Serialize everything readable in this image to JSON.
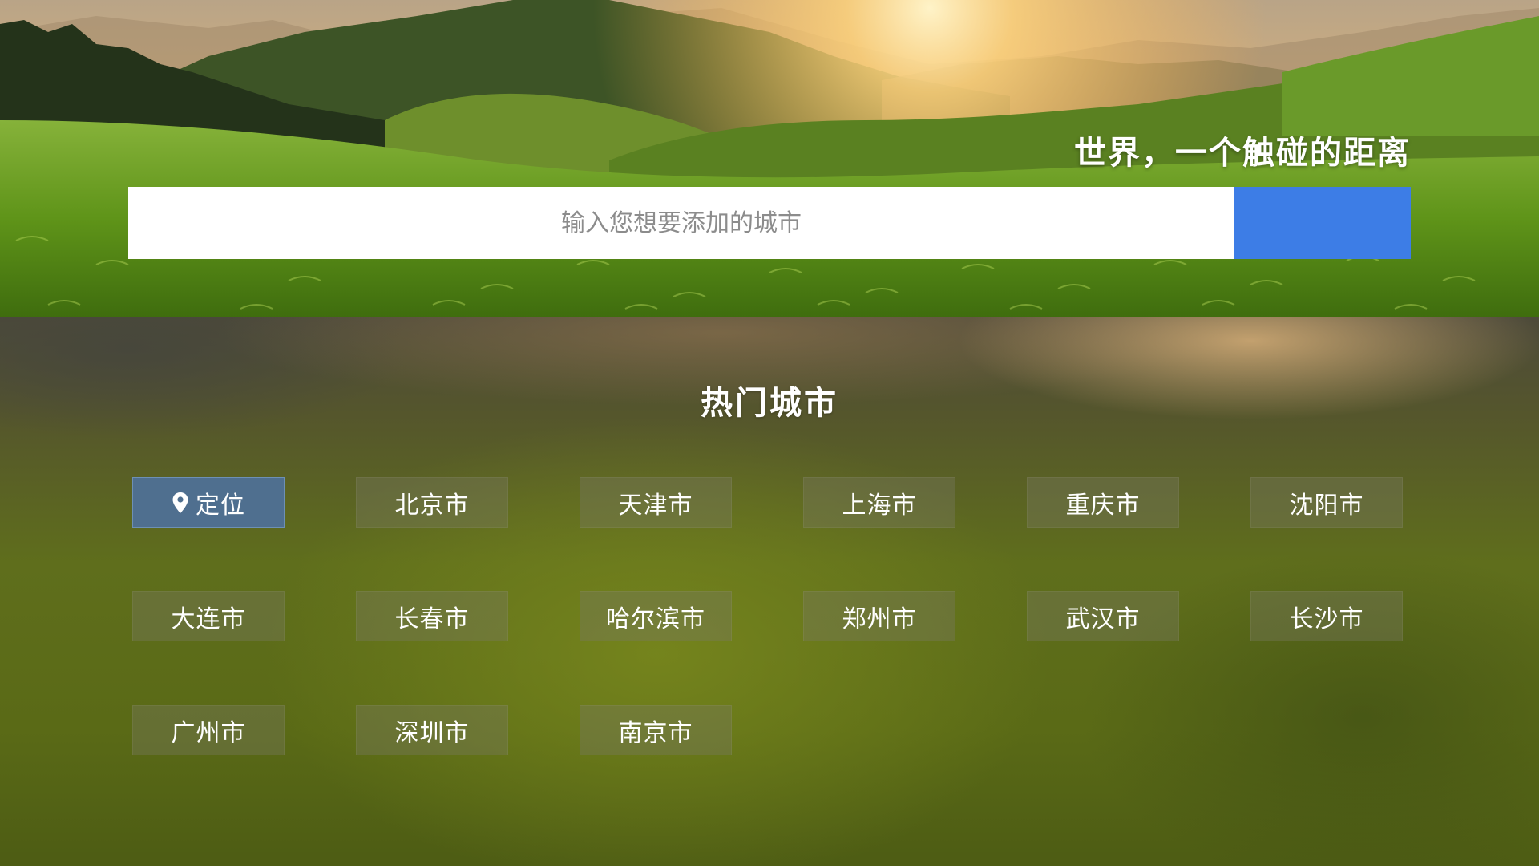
{
  "header": {
    "tagline": "世界，一个触碰的距离"
  },
  "search": {
    "placeholder": "输入您想要添加的城市",
    "value": "",
    "button_icon": "search-icon",
    "button_color": "#3d7de6"
  },
  "hot_cities": {
    "title": "热门城市",
    "locate_label": "定位",
    "locate_icon": "location-pin-icon",
    "locate_color": "#4f6f8f",
    "cities": [
      "北京市",
      "天津市",
      "上海市",
      "重庆市",
      "沈阳市",
      "大连市",
      "长春市",
      "哈尔滨市",
      "郑州市",
      "武汉市",
      "长沙市",
      "广州市",
      "深圳市",
      "南京市"
    ]
  }
}
